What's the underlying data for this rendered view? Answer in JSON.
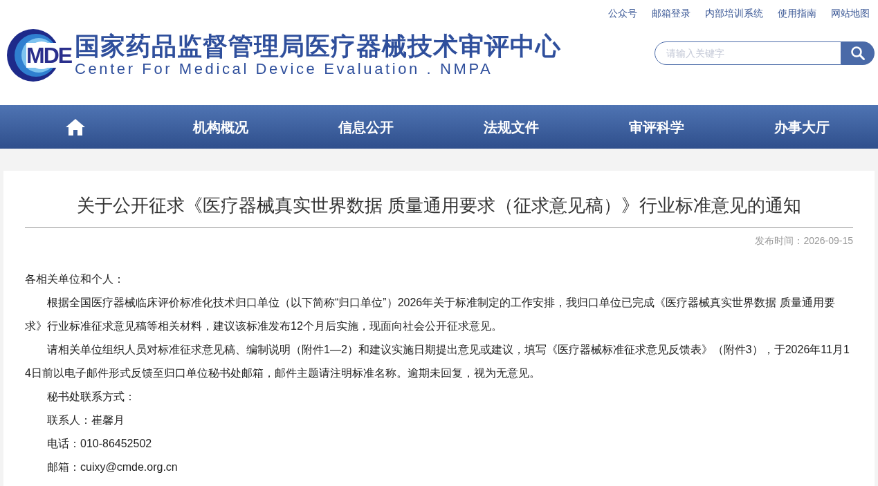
{
  "top_links": [
    "公众号",
    "邮箱登录",
    "内部培训系统",
    "使用指南",
    "网站地图"
  ],
  "logo": {
    "mark": "MDE",
    "title": "国家药品监督管理局医疗器械技术审评中心",
    "subtitle": "Center For Medical Device Evaluation . NMPA"
  },
  "search": {
    "placeholder": "请输入关键字"
  },
  "nav": [
    {
      "kind": "home"
    },
    {
      "kind": "text",
      "label": "机构概况"
    },
    {
      "kind": "text",
      "label": "信息公开"
    },
    {
      "kind": "text",
      "label": "法规文件"
    },
    {
      "kind": "text",
      "label": "审评科学"
    },
    {
      "kind": "text",
      "label": "办事大厅"
    }
  ],
  "article": {
    "title": "关于公开征求《医疗器械真实世界数据 质量通用要求（征求意见稿）》行业标准意见的通知",
    "date": "发布时间：2026-09-15",
    "paragraphs": [
      {
        "kind": "plain",
        "text": "各相关单位和个人："
      },
      {
        "kind": "indent",
        "text": "根据全国医疗器械临床评价标准化技术归口单位（以下简称“归口单位”）2026年关于标准制定的工作安排，我归口单位已完成《医疗器械真实世界数据 质量通用要求》行业标准征求意见稿等相关材料，建议该标准发布12个月后实施，现面向社会公开征求意见。"
      },
      {
        "kind": "indent",
        "text": "请相关单位组织人员对标准征求意见稿、编制说明（附件1—2）和建议实施日期提出意见或建议，填写《医疗器械标准征求意见反馈表》（附件3），于2026年11月14日前以电子邮件形式反馈至归口单位秘书处邮箱，邮件主题请注明标准名称。逾期未回复，视为无意见。"
      },
      {
        "kind": "indent",
        "text": "秘书处联系方式："
      },
      {
        "kind": "indent",
        "text": "联系人：崔馨月"
      },
      {
        "kind": "indent",
        "text": "电话：010-86452502"
      },
      {
        "kind": "indent",
        "text": "邮箱：cuixy@cmde.org.cn"
      }
    ]
  }
}
